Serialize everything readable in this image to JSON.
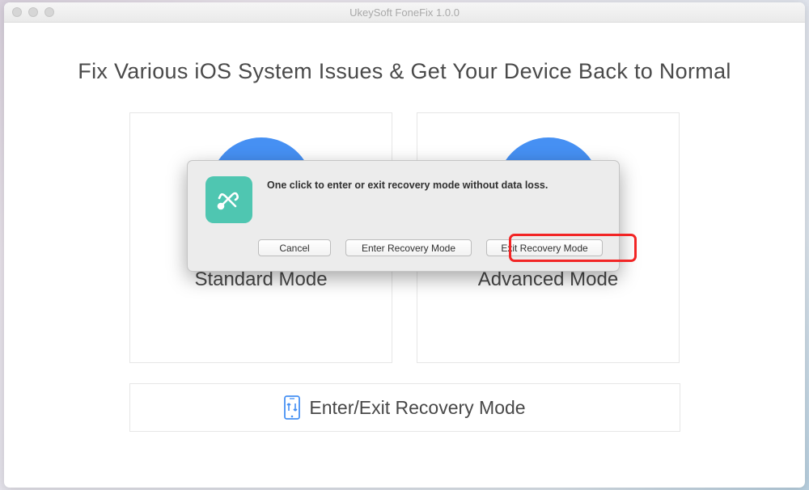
{
  "window": {
    "title": "UkeySoft FoneFix 1.0.0"
  },
  "main": {
    "heading": "Fix Various iOS System Issues & Get Your Device Back to Normal",
    "modes": {
      "standard": {
        "label": "Standard Mode",
        "icon": "phone-cross-icon"
      },
      "advanced": {
        "label": "Advanced Mode",
        "icon": "gear-icon"
      }
    },
    "recovery": {
      "label": "Enter/Exit Recovery Mode",
      "icon": "phone-arrows-icon"
    }
  },
  "dialog": {
    "icon": "tools-icon",
    "message": "One click to enter or exit recovery mode without data loss.",
    "buttons": {
      "cancel": "Cancel",
      "enter": "Enter Recovery Mode",
      "exit": "Exit Recovery Mode"
    }
  }
}
